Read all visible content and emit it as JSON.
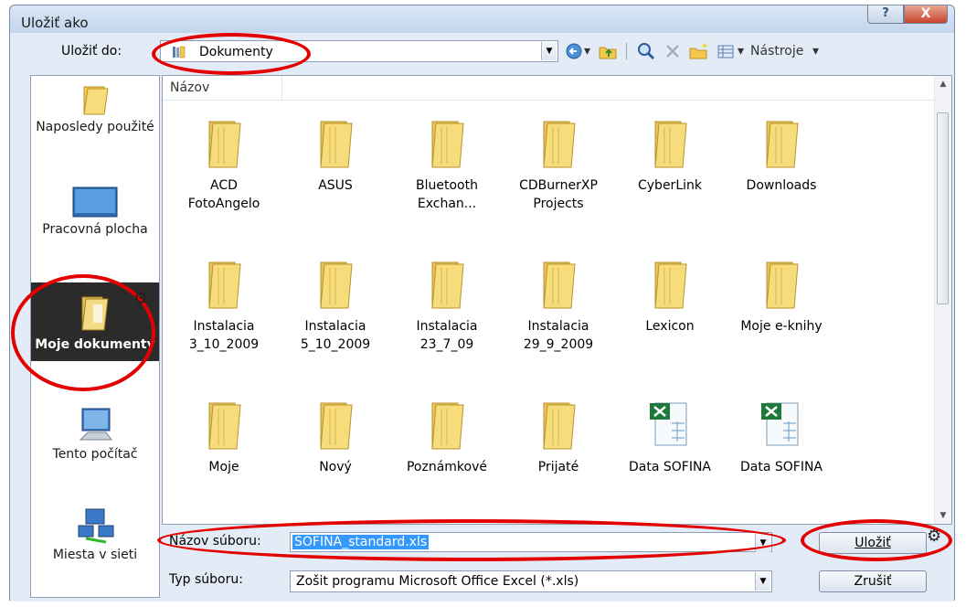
{
  "window": {
    "title": "Uložiť ako",
    "help_glyph": "?",
    "close_glyph": "X"
  },
  "look_in": {
    "label": "Uložiť do:",
    "value": "Dokumenty",
    "icon": "library-icon"
  },
  "toolbar": {
    "tools_label": "Nástroje",
    "dropdown_glyph": "▾"
  },
  "places": [
    {
      "label": "Naposledy použité",
      "icon": "recent-folder-icon"
    },
    {
      "label": "Pracovná plocha",
      "icon": "desktop-icon"
    },
    {
      "label": "Moje dokumenty",
      "icon": "documents-folder-icon",
      "selected": true
    },
    {
      "label": "Tento počítač",
      "icon": "computer-icon"
    },
    {
      "label": "Miesta v sieti",
      "icon": "network-icon"
    }
  ],
  "file_list": {
    "column_header": "Názov",
    "items": [
      {
        "label": "ACD FotoAngelo",
        "kind": "folder"
      },
      {
        "label": "ASUS",
        "kind": "folder"
      },
      {
        "label": "Bluetooth Exchan...",
        "kind": "folder"
      },
      {
        "label": "CDBurnerXP Projects",
        "kind": "folder"
      },
      {
        "label": "CyberLink",
        "kind": "folder"
      },
      {
        "label": "Downloads",
        "kind": "folder"
      },
      {
        "label": "Instalacia 3_10_2009",
        "kind": "folder"
      },
      {
        "label": "Instalacia 5_10_2009",
        "kind": "folder"
      },
      {
        "label": "Instalacia 23_7_09",
        "kind": "folder"
      },
      {
        "label": "Instalacia 29_9_2009",
        "kind": "folder"
      },
      {
        "label": "Lexicon",
        "kind": "folder"
      },
      {
        "label": "Moje e-knihy",
        "kind": "folder"
      },
      {
        "label": "Moje",
        "kind": "folder"
      },
      {
        "label": "Nový",
        "kind": "folder"
      },
      {
        "label": "Poznámkové",
        "kind": "folder"
      },
      {
        "label": "Prijaté",
        "kind": "folder"
      },
      {
        "label": "Data SOFINA",
        "kind": "excel"
      },
      {
        "label": "Data SOFINA",
        "kind": "excel"
      }
    ]
  },
  "file_name": {
    "label": "Názov súboru:",
    "value": "SOFINA_standard.xls"
  },
  "file_type": {
    "label": "Typ súboru:",
    "value": "Zošit programu Microsoft Office Excel (*.xls)"
  },
  "buttons": {
    "save": "Uložiť",
    "cancel": "Zrušiť"
  },
  "colors": {
    "highlight_ring": "#e30000",
    "selection": "#3399ff",
    "folder": "#f2c94c"
  }
}
